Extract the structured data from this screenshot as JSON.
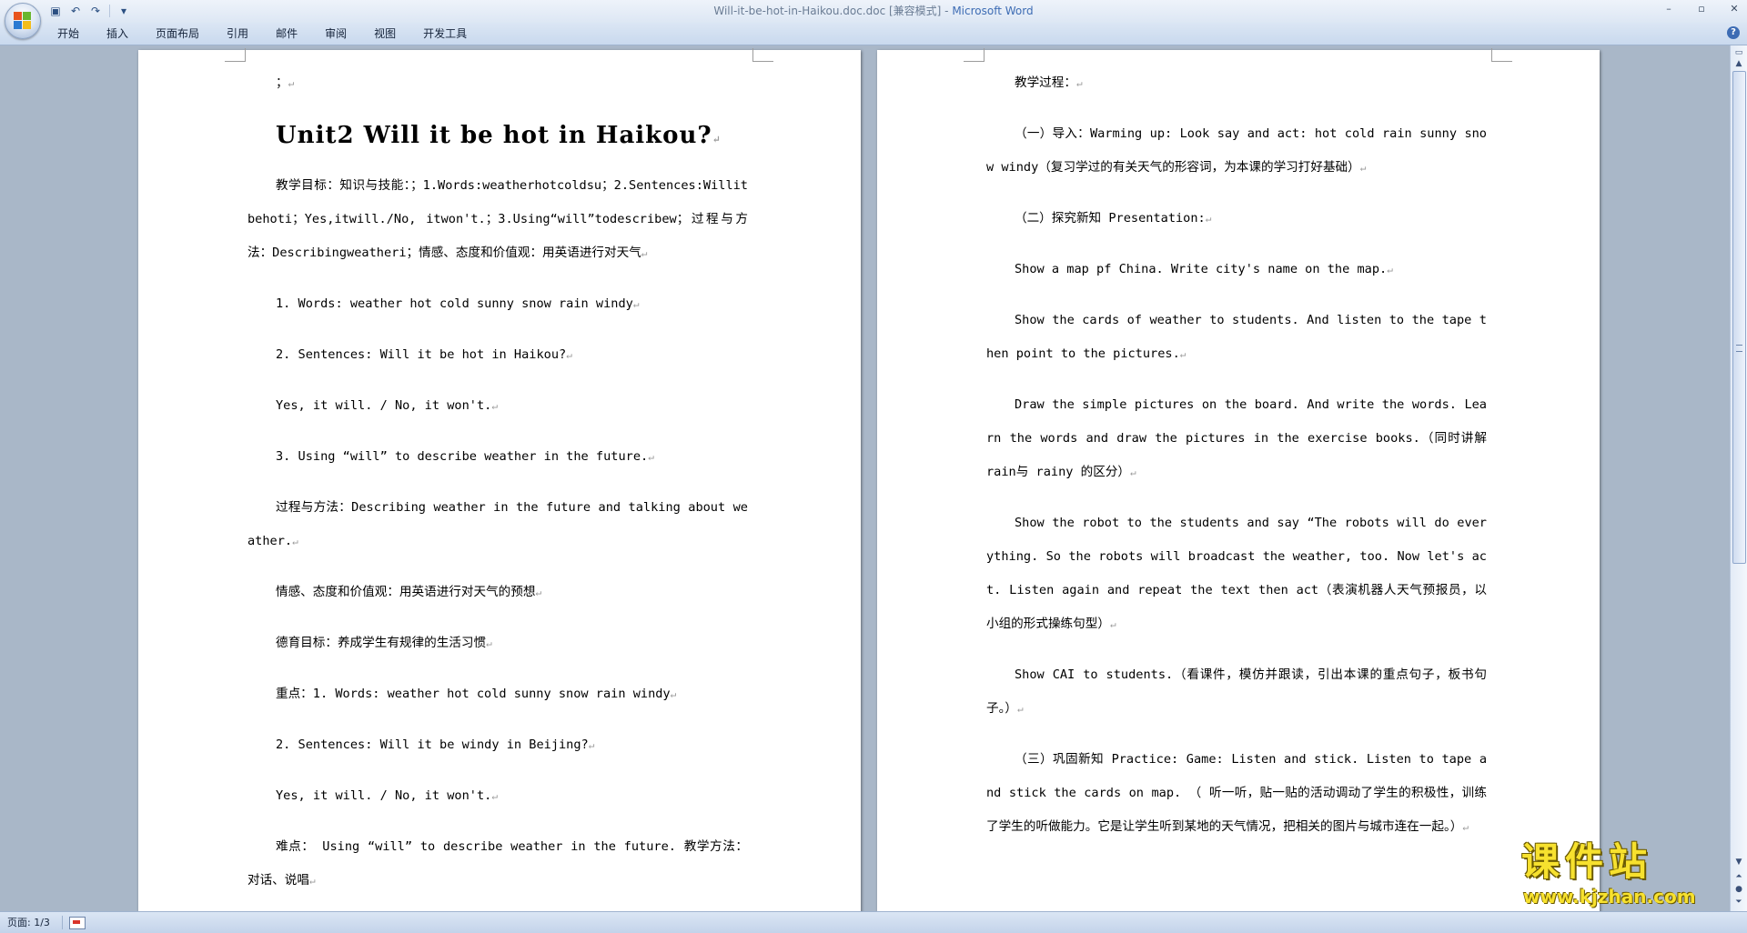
{
  "window": {
    "title_prefix": "Will-it-be-hot-in-Haikou.doc.doc [兼容模式] - ",
    "title_app": "Microsoft Word"
  },
  "qat": [
    {
      "icon": "save-icon",
      "glyph": "▣"
    },
    {
      "icon": "undo-icon",
      "glyph": "↶"
    },
    {
      "icon": "redo-icon",
      "glyph": "↷"
    },
    {
      "icon": "customize-qat-icon",
      "glyph": "▾"
    }
  ],
  "window_controls": [
    {
      "icon": "minimize-icon",
      "glyph": "–"
    },
    {
      "icon": "maximize-icon",
      "glyph": "▫"
    },
    {
      "icon": "close-icon",
      "glyph": "✕"
    }
  ],
  "ribbon": {
    "tabs": [
      "开始",
      "插入",
      "页面布局",
      "引用",
      "邮件",
      "审阅",
      "视图",
      "开发工具"
    ]
  },
  "left_page": {
    "paragraphs": [
      {
        "type": "text",
        "text": "；"
      },
      {
        "type": "title",
        "text": "Unit2 Will it be hot in Haikou?"
      },
      {
        "type": "text",
        "text": "教学目标：知识与技能：；1.Words:weatherhotcoldsu；2.Sentences:Willitbehoti；Yes,itwill./No, itwon't.；3.Using“will”todescribew；过程与方法：Describingweatheri；情感、态度和价值观：用英语进行对天气"
      },
      {
        "type": "text",
        "text": "1. Words: weather hot cold sunny snow rain windy"
      },
      {
        "type": "text",
        "text": "2. Sentences: Will it be hot in Haikou?"
      },
      {
        "type": "text",
        "text": "Yes, it will. / No,  it won't."
      },
      {
        "type": "text",
        "text": "3. Using “will” to describe weather in the future."
      },
      {
        "type": "text",
        "text": "过程与方法：Describing weather in the future and talking about weather."
      },
      {
        "type": "text",
        "text": "情感、态度和价值观：用英语进行对天气的预想"
      },
      {
        "type": "text",
        "text": "德育目标：养成学生有规律的生活习惯"
      },
      {
        "type": "text",
        "text": "重点：1. Words: weather hot cold sunny snow rain windy"
      },
      {
        "type": "text",
        "text": "2. Sentences: Will it be windy in Beijing?"
      },
      {
        "type": "text",
        "text": "Yes, it will. / No,  it won't."
      },
      {
        "type": "text",
        "text": "难点： Using “will” to describe weather in the future. 教学方法：对话、说唱"
      }
    ]
  },
  "right_page": {
    "paragraphs": [
      {
        "type": "text",
        "text": "教学过程："
      },
      {
        "type": "text",
        "text": "（一）导入：Warming up: Look say and act: hot cold rain sunny snow windy（复习学过的有关天气的形容词，为本课的学习打好基础）"
      },
      {
        "type": "text",
        "text": "（二）探究新知 Presentation:"
      },
      {
        "type": "text",
        "text": "Show a map pf China. Write city's name on the map."
      },
      {
        "type": "text",
        "text": "Show the cards of weather to students. And listen to the tape then point to the pictures."
      },
      {
        "type": "text",
        "text": "Draw the simple pictures on the board. And write the words. Learn the words and draw the pictures in the exercise books.（同时讲解 rain与 rainy 的区分）"
      },
      {
        "type": "text",
        "text": "Show the robot to the students and say “The robots will do everything. So the robots will broadcast the weather, too. Now let's act. Listen again and repeat the text then act（表演机器人天气预报员，以小组的形式操练句型）"
      },
      {
        "type": "text",
        "text": "Show CAI to students.（看课件，模仿并跟读，引出本课的重点句子，板书句子。）"
      },
      {
        "type": "text",
        "text": "（三）巩固新知 Practice: Game: Listen and stick. Listen to tape and stick the cards on map. （ 听一听，贴一贴的活动调动了学生的积极性，训练了学生的听做能力。它是让学生听到某地的天气情况，把相关的图片与城市连在一起。）"
      }
    ]
  },
  "paragraph_mark": "↵",
  "statusbar": {
    "page_info": "页面: 1/3"
  },
  "watermark": {
    "main": "课件站",
    "url": "www.kjzhan.com"
  }
}
